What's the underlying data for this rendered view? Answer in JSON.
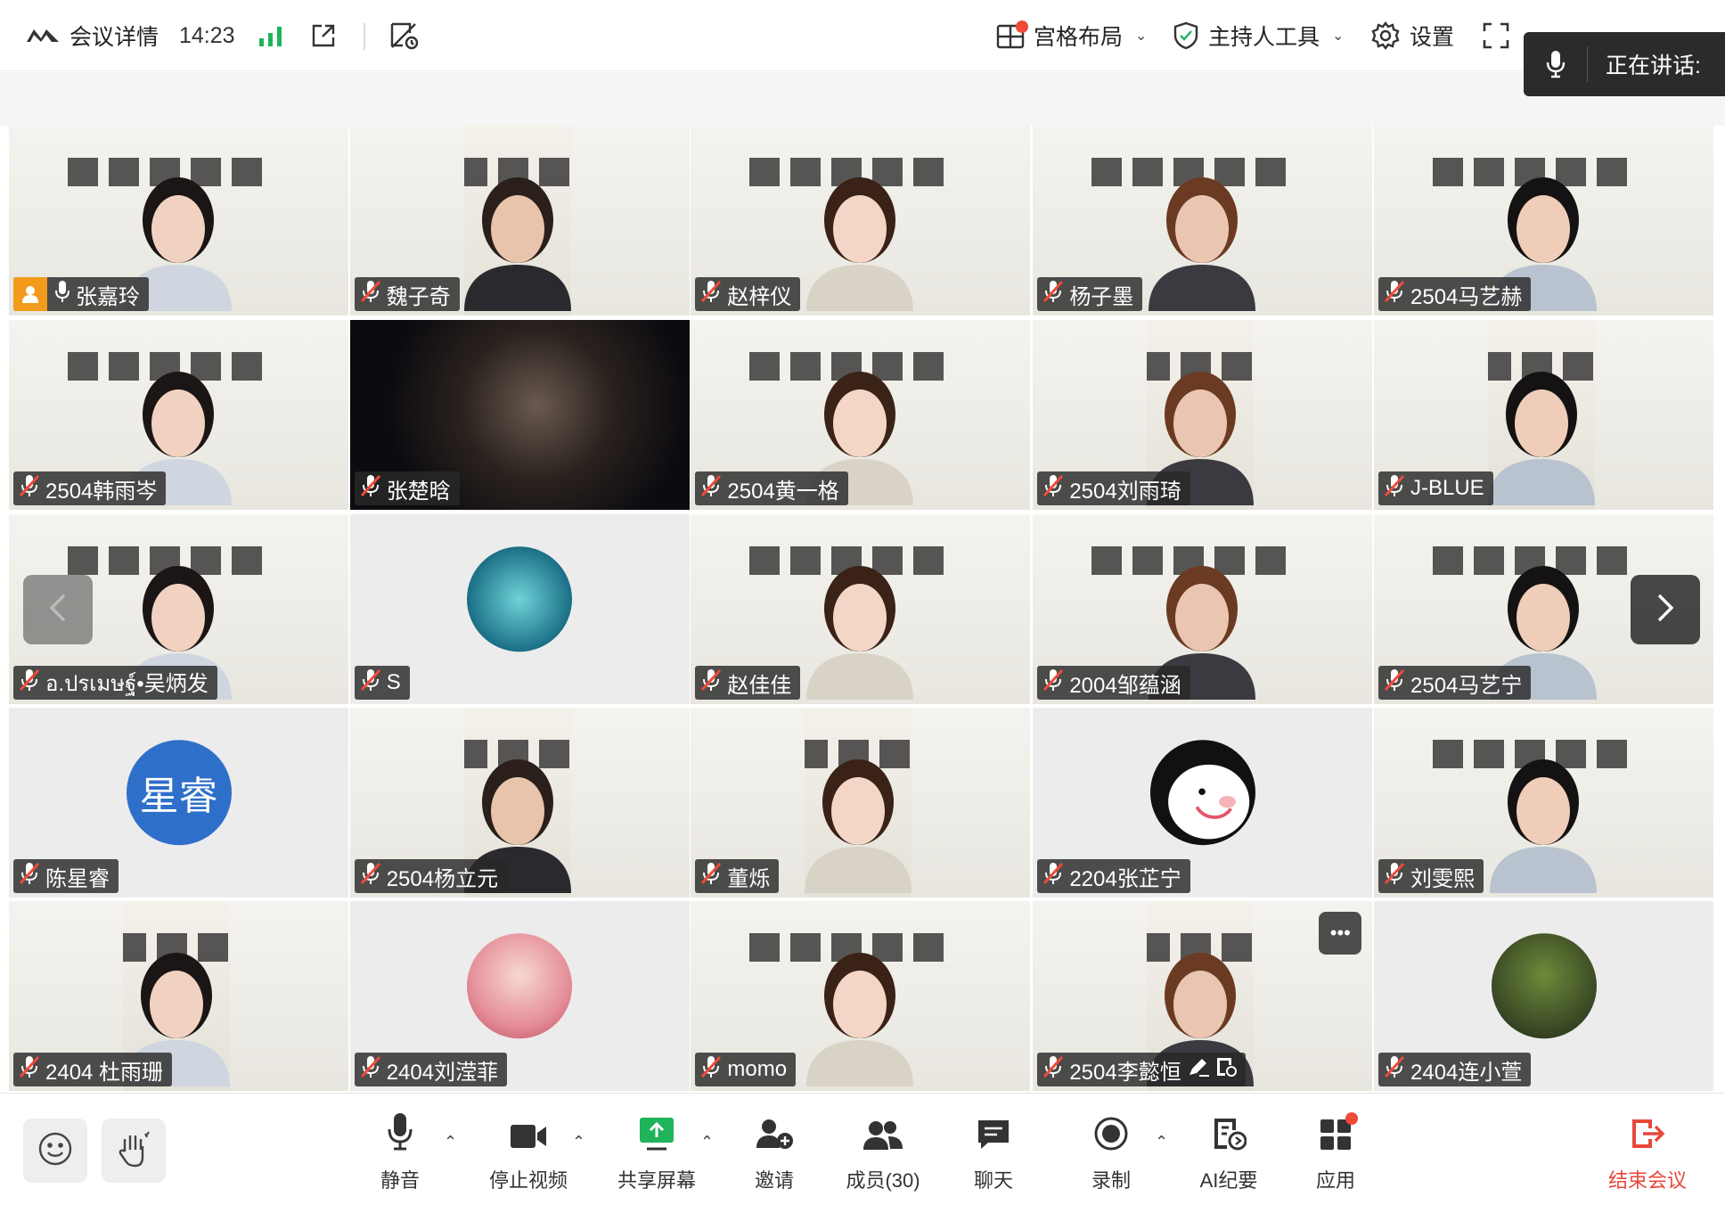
{
  "topbar": {
    "title": "会议详情",
    "time": "14:23",
    "layout_label": "宫格布局",
    "host_tools_label": "主持人工具",
    "settings_label": "设置"
  },
  "speaking": {
    "label": "正在讲话:"
  },
  "participants": [
    "张嘉玲",
    "魏子奇",
    "赵梓仪",
    "杨子墨",
    "2504马艺赫",
    "2504韩雨岑",
    "张楚晗",
    "2504黄一格",
    "2504刘雨琦",
    "J-BLUE",
    "อ.ปรเมษฐ์•吴炳发",
    "S",
    "赵佳佳",
    "2004邹蕴涵",
    "2504马艺宁",
    "陈星睿",
    "2504杨立元",
    "董烁",
    "2204张芷宁",
    "刘雯熙",
    "2404 杜雨珊",
    "2404刘滢菲",
    "momo",
    "2504李懿恒",
    "2404连小萱"
  ],
  "avatar_initials": {
    "chenxingrui": "星睿"
  },
  "toolbar": {
    "mute": "静音",
    "stop_video": "停止视频",
    "share_screen": "共享屏幕",
    "invite": "邀请",
    "members": "成员(30)",
    "chat": "聊天",
    "record": "录制",
    "ai_notes": "AI纪要",
    "apps": "应用",
    "end_meeting": "结束会议"
  },
  "colors": {
    "accent_green": "#1fb35a",
    "end_red": "#e8473b",
    "host_orange": "#f29b1c",
    "avatar_blue": "#2e6fc9"
  }
}
